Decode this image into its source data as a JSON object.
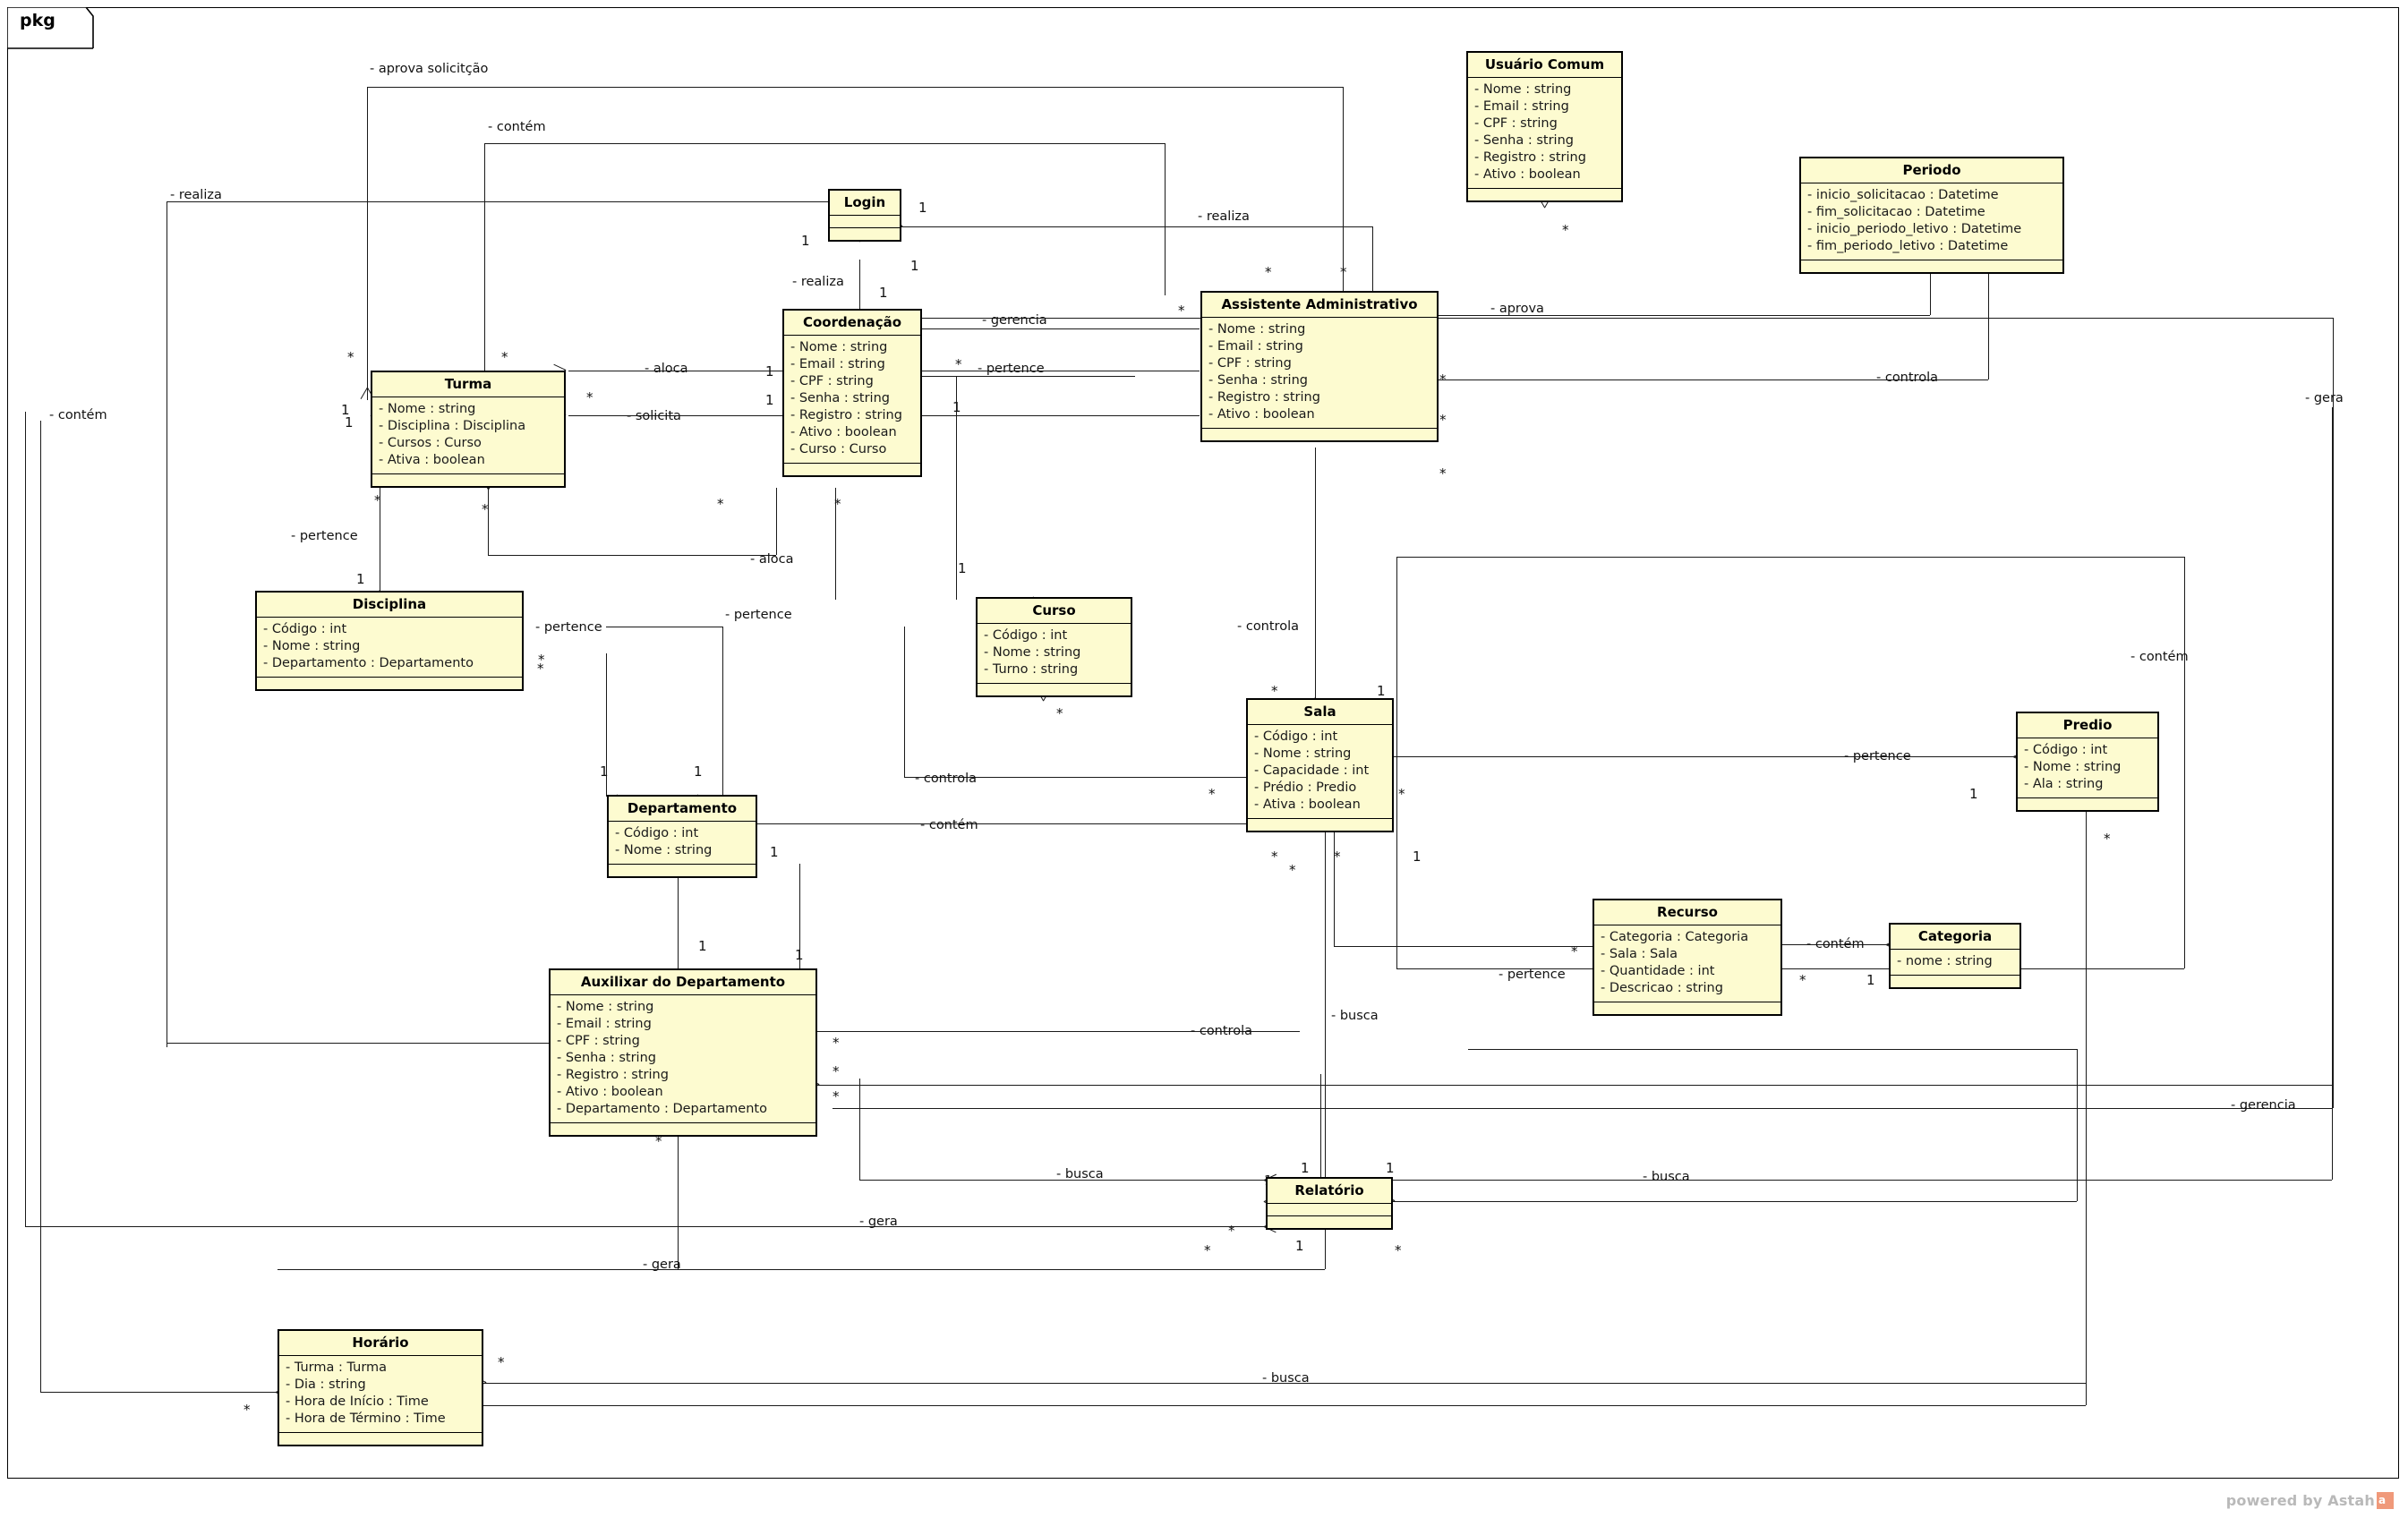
{
  "diagram": {
    "package_label": "pkg",
    "watermark": "powered by Astah",
    "watermark_logo": "astah-logo-icon",
    "colors": {
      "class_fill": "#fdfbd0",
      "class_border": "#000000",
      "line": "#1a1a1a",
      "watermark": "#b9b9b9",
      "logo": "#f0997a"
    }
  },
  "classes": [
    {
      "id": "usuario_comum",
      "name": "Usuário Comum",
      "attributes": [
        "- Nome : string",
        "- Email : string",
        "- CPF : string",
        "- Senha : string",
        "- Registro : string",
        "- Ativo : boolean"
      ]
    },
    {
      "id": "periodo",
      "name": "Periodo",
      "attributes": [
        "- inicio_solicitacao : Datetime",
        "- fim_solicitacao : Datetime",
        "- inicio_periodo_letivo : Datetime",
        "- fim_periodo_letivo : Datetime"
      ]
    },
    {
      "id": "login",
      "name": "Login",
      "attributes": []
    },
    {
      "id": "assistente",
      "name": "Assistente Administrativo",
      "attributes": [
        "- Nome : string",
        "- Email : string",
        "- CPF : string",
        "- Senha : string",
        "- Registro : string",
        "- Ativo : boolean"
      ]
    },
    {
      "id": "coordenacao",
      "name": "Coordenação",
      "attributes": [
        "- Nome : string",
        "- Email : string",
        "- CPF : string",
        "- Senha : string",
        "- Registro : string",
        "- Ativo : boolean",
        "- Curso : Curso"
      ]
    },
    {
      "id": "turma",
      "name": "Turma",
      "attributes": [
        "- Nome : string",
        "- Disciplina : Disciplina",
        "- Cursos : Curso",
        "- Ativa : boolean"
      ]
    },
    {
      "id": "disciplina",
      "name": "Disciplina",
      "attributes": [
        "- Código : int",
        "- Nome : string",
        "- Departamento : Departamento"
      ]
    },
    {
      "id": "curso",
      "name": "Curso",
      "attributes": [
        "- Código : int",
        "- Nome : string",
        "- Turno : string"
      ]
    },
    {
      "id": "departamento",
      "name": "Departamento",
      "attributes": [
        "- Código : int",
        "- Nome : string"
      ]
    },
    {
      "id": "auxiliar",
      "name": "Auxilixar do Departamento",
      "attributes": [
        "- Nome : string",
        "- Email : string",
        "- CPF : string",
        "- Senha : string",
        "- Registro : string",
        "- Ativo : boolean",
        "- Departamento : Departamento"
      ]
    },
    {
      "id": "sala",
      "name": "Sala",
      "attributes": [
        "- Código : int",
        "- Nome : string",
        "- Capacidade : int",
        "- Prédio : Predio",
        "- Ativa : boolean"
      ]
    },
    {
      "id": "predio",
      "name": "Predio",
      "attributes": [
        "- Código : int",
        "- Nome : string",
        "- Ala : string"
      ]
    },
    {
      "id": "recurso",
      "name": "Recurso",
      "attributes": [
        "- Categoria : Categoria",
        "- Sala : Sala",
        "- Quantidade : int",
        "- Descricao : string"
      ]
    },
    {
      "id": "categoria",
      "name": "Categoria",
      "attributes": [
        "- nome : string"
      ]
    },
    {
      "id": "relatorio",
      "name": "Relatório",
      "attributes": []
    },
    {
      "id": "horario",
      "name": "Horário",
      "attributes": [
        "- Turma : Turma",
        "- Dia : string",
        "- Hora de Início : Time",
        "- Hora de Término : Time"
      ]
    }
  ],
  "edge_labels": [
    "- aprova solicitção",
    "- contém",
    "- realiza",
    "- realiza",
    "- realiza",
    "- gerencia",
    "- aprova",
    "- controla",
    "- aloca",
    "- solicita",
    "- pertence",
    "- pertence",
    "- contém",
    "- gera",
    "- pertence",
    "- aloca",
    "- pertence",
    "- contém",
    "- controla",
    "- pertence",
    "- controla",
    "- contém",
    "- contém",
    "- pertence",
    "- busca",
    "- controla",
    "- gerencia",
    "- busca",
    "- busca",
    "- gera",
    "- gera",
    "- busca"
  ],
  "multiplicities": [
    "1",
    "*"
  ]
}
